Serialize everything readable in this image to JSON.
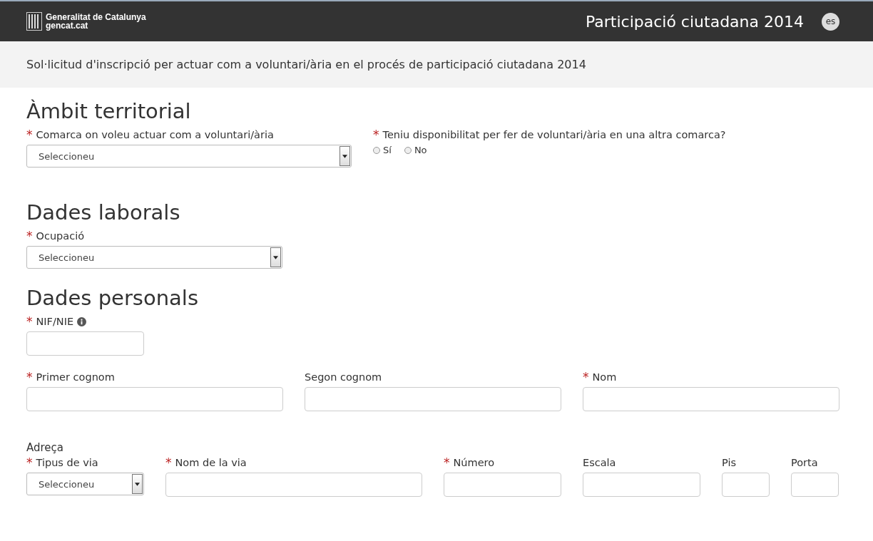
{
  "header": {
    "brand_name": "Generalitat de Catalunya",
    "brand_site": "gencat.cat",
    "title": "Participació ciutadana 2014",
    "language": "es"
  },
  "intro": "Sol·licitud d'inscripció per actuar com a voluntari/ària en el procés de participació ciutadana 2014",
  "sections": [
    {
      "title": "Àmbit territorial",
      "rows": [
        [
          {
            "kind": "select",
            "required_mark": "*",
            "label": "Comarca on voleu actuar com a voluntari/ària",
            "value": "Seleccioneu"
          },
          {
            "kind": "radio",
            "required_mark": "*",
            "label": "Teniu disponibilitat per fer de voluntari/ària en una altra comarca?",
            "options": [
              {
                "label": "Sí",
                "selected": false
              },
              {
                "label": "No",
                "selected": false
              }
            ]
          }
        ]
      ]
    },
    {
      "title": "Dades laborals",
      "rows": [
        [
          {
            "kind": "select",
            "required_mark": "*",
            "label": "Ocupació",
            "value": "Seleccioneu"
          }
        ]
      ]
    },
    {
      "title": "Dades personals",
      "rows": [
        [
          {
            "kind": "text",
            "required_mark": "*",
            "label": "NIF/NIE",
            "info": true
          }
        ],
        [
          {
            "kind": "text",
            "required_mark": "*",
            "label": "Primer cognom"
          },
          {
            "kind": "text",
            "label": "Segon cognom"
          },
          {
            "kind": "text",
            "required_mark": "*",
            "label": "Nom"
          }
        ]
      ],
      "subsection": {
        "title": "Adreça",
        "rows": [
          [
            {
              "kind": "select",
              "required_mark": "*",
              "label": "Tipus de via",
              "value": "Seleccioneu"
            },
            {
              "kind": "text",
              "required_mark": "*",
              "label": "Nom de la via"
            },
            {
              "kind": "text",
              "required_mark": "*",
              "label": "Número"
            },
            {
              "kind": "text",
              "label": "Escala"
            },
            {
              "kind": "text",
              "label": "Pis"
            },
            {
              "kind": "text",
              "label": "Porta"
            }
          ]
        ]
      }
    }
  ]
}
